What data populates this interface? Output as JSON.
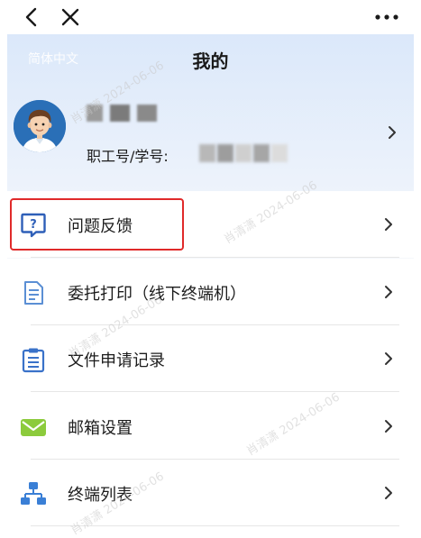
{
  "nav": {
    "back_icon": "chevron-left-icon",
    "close_icon": "close-icon",
    "more_icon": "more-horizontal-icon"
  },
  "header": {
    "language": "简体中文",
    "title": "我的"
  },
  "profile": {
    "id_label": "职工号/学号:"
  },
  "menu": [
    {
      "label": "问题反馈",
      "icon": "feedback-question-icon",
      "icon_color": "#2e5fb8"
    },
    {
      "label": "委托打印（线下终端机）",
      "icon": "document-icon",
      "icon_color": "#5b8fd4"
    },
    {
      "label": "文件申请记录",
      "icon": "clipboard-list-icon",
      "icon_color": "#3a72c9"
    },
    {
      "label": "邮箱设置",
      "icon": "mail-icon",
      "icon_color": "#8ccb3c"
    },
    {
      "label": "终端列表",
      "icon": "network-tree-icon",
      "icon_color": "#3a7fd6"
    }
  ],
  "watermark": "肖清潇 2024-06-06",
  "colors": {
    "header_top": "#dbe8fa",
    "highlight": "#e02a2a",
    "divider": "#e6e6e6"
  }
}
